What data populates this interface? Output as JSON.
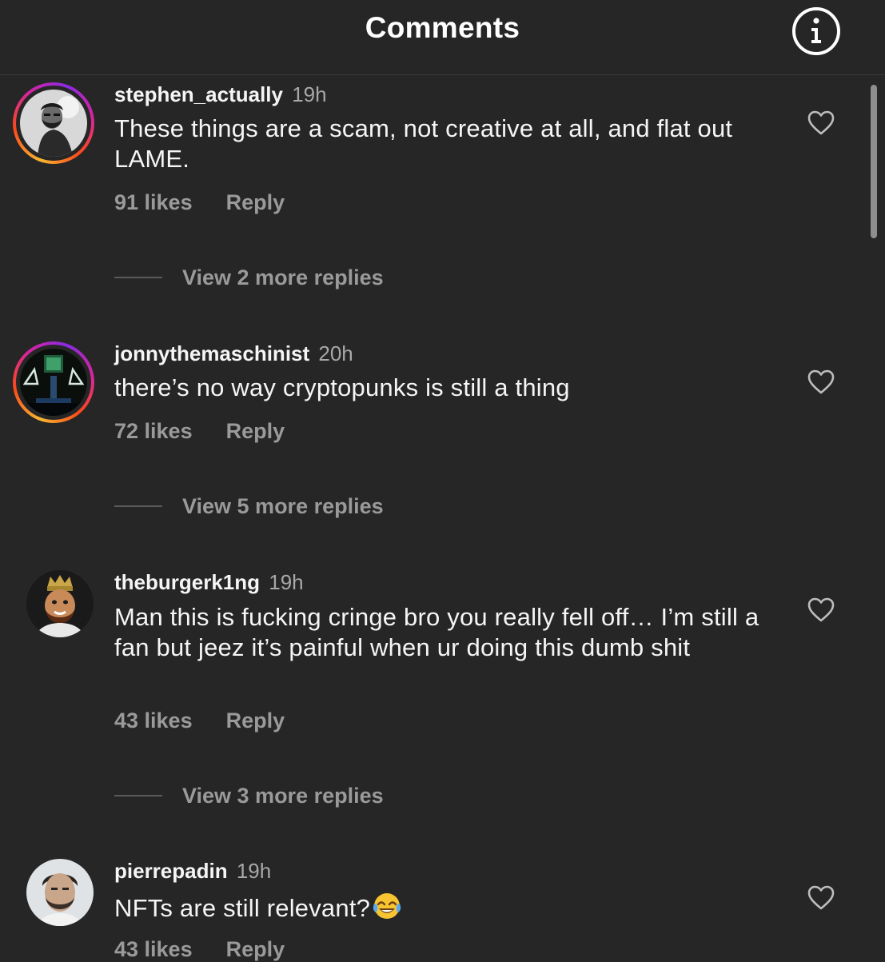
{
  "header": {
    "title": "Comments",
    "info_icon": "info-circle-icon"
  },
  "comments": [
    {
      "username": "stephen_actually",
      "time": "19h",
      "text": "These things are a scam, not creative at all, and flat out LAME.",
      "likes": "91 likes",
      "reply": "Reply",
      "view_more": "View 2 more replies",
      "avatar": "bearded-man-avatar",
      "story_ring": true
    },
    {
      "username": "jonnythemaschinist",
      "time": "20h",
      "text": "there’s no way cryptopunks is still a thing",
      "likes": "72 likes",
      "reply": "Reply",
      "view_more": "View 5 more replies",
      "avatar": "stage-lights-avatar",
      "story_ring": true
    },
    {
      "username": "theburgerk1ng",
      "time": "19h",
      "text": "Man this is fucking cringe bro you really fell off… I’m still a fan but jeez it’s painful when ur doing this dumb shit",
      "likes": "43 likes",
      "reply": "Reply",
      "view_more": "View 3 more replies",
      "avatar": "burger-king-mascot-avatar",
      "story_ring": false
    },
    {
      "username": "pierrepadin",
      "time": "19h",
      "text": "NFTs are still relevant?",
      "emoji": "face-with-tears-of-joy-emoji",
      "likes": "43 likes",
      "reply": "Reply",
      "avatar": "young-man-portrait-avatar",
      "story_ring": false
    }
  ],
  "colors": {
    "background": "#262626",
    "primary_text": "#f5f5f5",
    "secondary_text": "#9a9a9a",
    "story_ring_gradient": [
      "#f7b733",
      "#fc4a1a",
      "#d6249f",
      "#8a2be2"
    ]
  }
}
